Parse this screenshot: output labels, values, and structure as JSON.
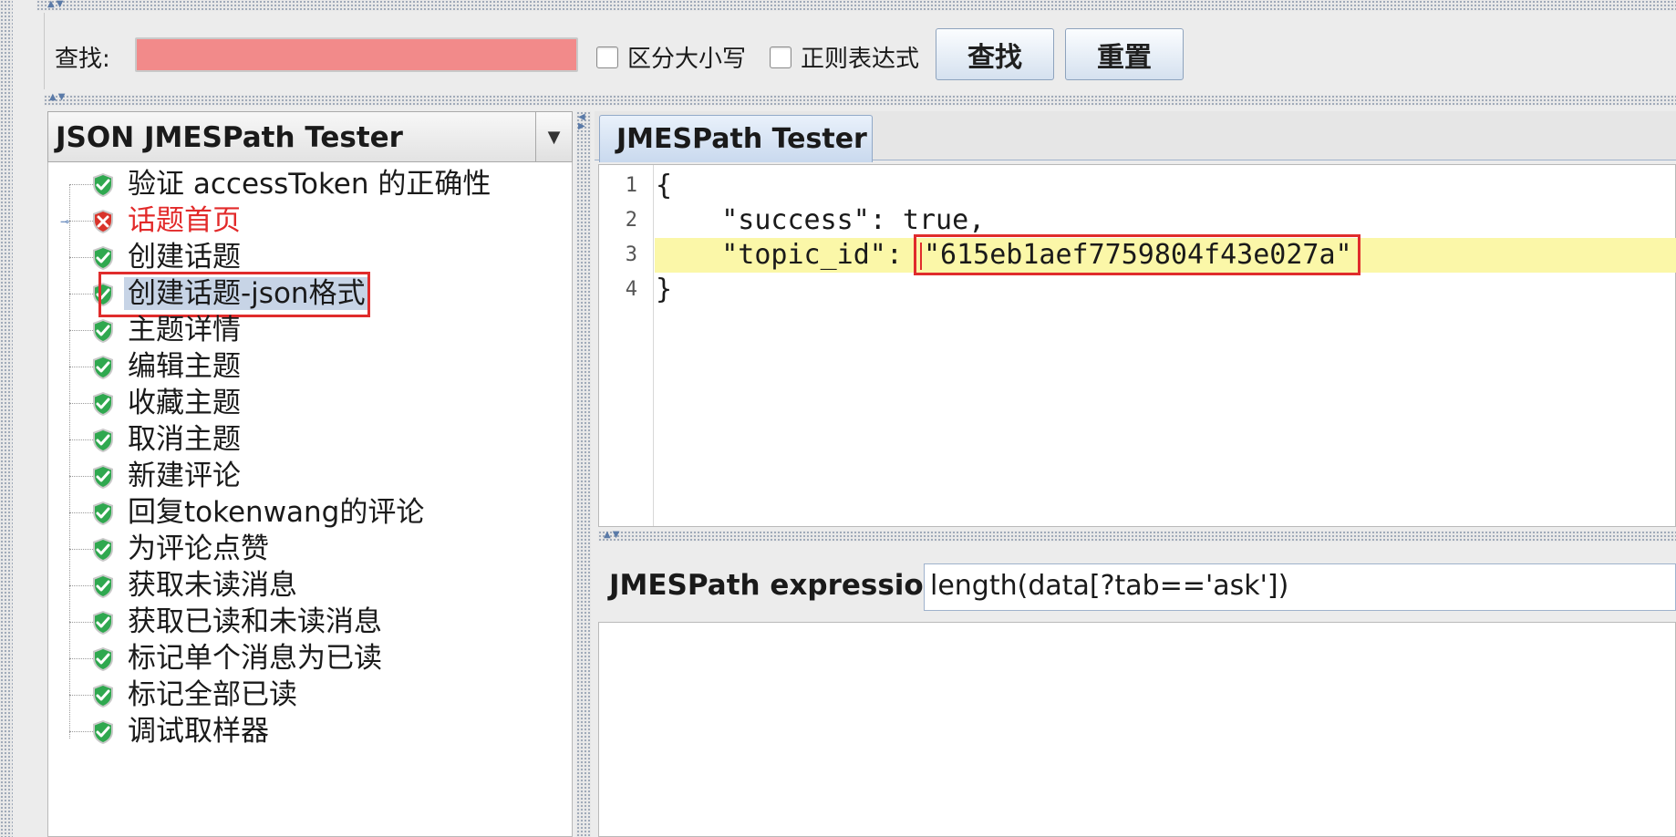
{
  "search": {
    "label": "查找:",
    "input_value": "",
    "case_sensitive_label": "区分大小写",
    "regex_label": "正则表达式",
    "find_button": "查找",
    "reset_button": "重置"
  },
  "left_panel": {
    "combo_value": "JSON JMESPath Tester",
    "tree_items": [
      {
        "label": "验证 accessToken 的正确性",
        "status": "success"
      },
      {
        "label": "话题首页",
        "status": "error"
      },
      {
        "label": "创建话题",
        "status": "success"
      },
      {
        "label": "创建话题-json格式",
        "status": "success",
        "selected": true
      },
      {
        "label": "主题详情",
        "status": "success"
      },
      {
        "label": "编辑主题",
        "status": "success"
      },
      {
        "label": "收藏主题",
        "status": "success"
      },
      {
        "label": "取消主题",
        "status": "success"
      },
      {
        "label": "新建评论",
        "status": "success"
      },
      {
        "label": "回复tokenwang的评论",
        "status": "success"
      },
      {
        "label": "为评论点赞",
        "status": "success"
      },
      {
        "label": "获取未读消息",
        "status": "success"
      },
      {
        "label": "获取已读和未读消息",
        "status": "success"
      },
      {
        "label": "标记单个消息为已读",
        "status": "success"
      },
      {
        "label": "标记全部已读",
        "status": "success"
      },
      {
        "label": "调试取样器",
        "status": "success"
      }
    ]
  },
  "right_panel": {
    "tab_label": "JMESPath Tester",
    "editor_lines": [
      {
        "num": "1",
        "text": "{"
      },
      {
        "num": "2",
        "text": "    \"success\": true,"
      },
      {
        "num": "3",
        "text": "    \"topic_id\": ",
        "value": "\"615eb1aef7759804f43e027a\""
      },
      {
        "num": "4",
        "text": "}"
      }
    ],
    "expression_label": "JMESPath expression",
    "expression_value": "length(data[?tab=='ask'])"
  },
  "colors": {
    "search_invalid": "#f28a8a",
    "error_text": "#e22a2a",
    "highlight_line": "#fbf7a8",
    "annotation_box": "#e02c2c"
  }
}
